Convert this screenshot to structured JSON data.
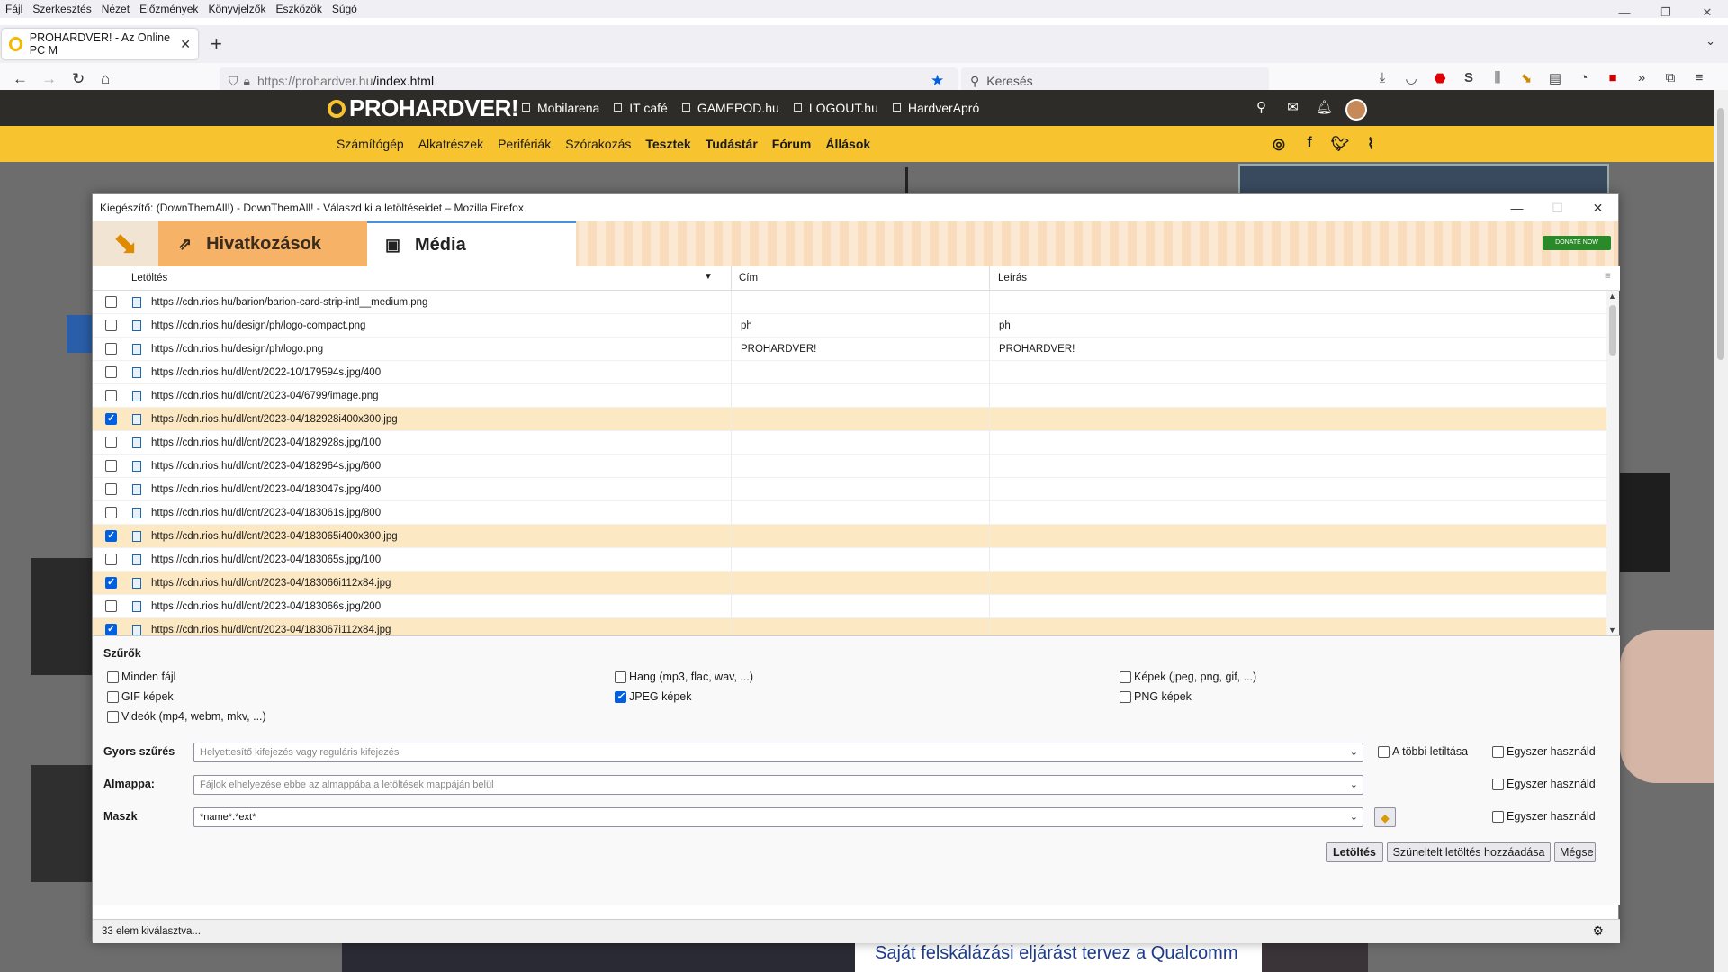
{
  "menubar": [
    "Fájl",
    "Szerkesztés",
    "Nézet",
    "Előzmények",
    "Könyvjelzők",
    "Eszközök",
    "Súgó"
  ],
  "tab": {
    "title": "PROHARDVER! - Az Online PC M"
  },
  "url": {
    "host": "https://prohardver.hu",
    "path": "/index.html"
  },
  "search": {
    "placeholder": "Keresés"
  },
  "site": {
    "logo": "PROHARDVER!",
    "links": [
      "Mobilarena",
      "IT café",
      "GAMEPOD.hu",
      "LOGOUT.hu",
      "HardverApró"
    ],
    "nav": [
      "Számítógép",
      "Alkatrészek",
      "Perifériák",
      "Szórakozás",
      "Tesztek",
      "Tudástár",
      "Fórum",
      "Állások"
    ],
    "headline": "Saját felskálázási eljárást tervez a Qualcomm"
  },
  "dialog": {
    "title": "Kiegészítő: (DownThemAll!) - DownThemAll! - Válaszd ki a letöltéseidet – Mozilla Firefox",
    "tabs": {
      "links": "Hivatkozások",
      "media": "Média"
    },
    "donate": "DONATE NOW",
    "columns": {
      "download": "Letöltés",
      "title": "Cím",
      "desc": "Leírás"
    },
    "rows": [
      {
        "url": "https://cdn.rios.hu/barion/barion-card-strip-intl__medium.png",
        "title": "",
        "desc": "",
        "checked": false
      },
      {
        "url": "https://cdn.rios.hu/design/ph/logo-compact.png",
        "title": "ph",
        "desc": "ph",
        "checked": false
      },
      {
        "url": "https://cdn.rios.hu/design/ph/logo.png",
        "title": "PROHARDVER!",
        "desc": "PROHARDVER!",
        "checked": false
      },
      {
        "url": "https://cdn.rios.hu/dl/cnt/2022-10/179594s.jpg/400",
        "title": "",
        "desc": "",
        "checked": false
      },
      {
        "url": "https://cdn.rios.hu/dl/cnt/2023-04/6799/image.png",
        "title": "",
        "desc": "",
        "checked": false
      },
      {
        "url": "https://cdn.rios.hu/dl/cnt/2023-04/182928i400x300.jpg",
        "title": "",
        "desc": "",
        "checked": true
      },
      {
        "url": "https://cdn.rios.hu/dl/cnt/2023-04/182928s.jpg/100",
        "title": "",
        "desc": "",
        "checked": false
      },
      {
        "url": "https://cdn.rios.hu/dl/cnt/2023-04/182964s.jpg/600",
        "title": "",
        "desc": "",
        "checked": false
      },
      {
        "url": "https://cdn.rios.hu/dl/cnt/2023-04/183047s.jpg/400",
        "title": "",
        "desc": "",
        "checked": false
      },
      {
        "url": "https://cdn.rios.hu/dl/cnt/2023-04/183061s.jpg/800",
        "title": "",
        "desc": "",
        "checked": false
      },
      {
        "url": "https://cdn.rios.hu/dl/cnt/2023-04/183065i400x300.jpg",
        "title": "",
        "desc": "",
        "checked": true
      },
      {
        "url": "https://cdn.rios.hu/dl/cnt/2023-04/183065s.jpg/100",
        "title": "",
        "desc": "",
        "checked": false
      },
      {
        "url": "https://cdn.rios.hu/dl/cnt/2023-04/183066i112x84.jpg",
        "title": "",
        "desc": "",
        "checked": true
      },
      {
        "url": "https://cdn.rios.hu/dl/cnt/2023-04/183066s.jpg/200",
        "title": "",
        "desc": "",
        "checked": false
      },
      {
        "url": "https://cdn.rios.hu/dl/cnt/2023-04/183067i112x84.jpg",
        "title": "",
        "desc": "",
        "checked": true
      }
    ],
    "filters_title": "Szűrők",
    "filters": [
      {
        "label": "Minden fájl",
        "checked": false
      },
      {
        "label": "Hang (mp3, flac, wav, ...)",
        "checked": false
      },
      {
        "label": "Képek (jpeg, png, gif, ...)",
        "checked": false
      },
      {
        "label": "GIF képek",
        "checked": false
      },
      {
        "label": "JPEG képek",
        "checked": true
      },
      {
        "label": "PNG képek",
        "checked": false
      },
      {
        "label": "Videók (mp4, webm, mkv, ...)",
        "checked": false
      }
    ],
    "quick": {
      "label": "Gyors szűrés",
      "placeholder": "Helyettesítő kifejezés vagy reguláris kifejezés",
      "disable_others": "A többi letiltása",
      "once": "Egyszer használd"
    },
    "subfolder": {
      "label": "Almappa:",
      "placeholder": "Fájlok elhelyezése ebbe az almappába a letöltések mappáján belül",
      "once": "Egyszer használd"
    },
    "mask": {
      "label": "Maszk",
      "value": "*name*.*ext*",
      "once": "Egyszer használd"
    },
    "buttons": {
      "download": "Letöltés",
      "paused": "Szüneltelt letöltés hozzáadása",
      "cancel": "Mégse"
    },
    "status": "33 elem kiválasztva..."
  }
}
